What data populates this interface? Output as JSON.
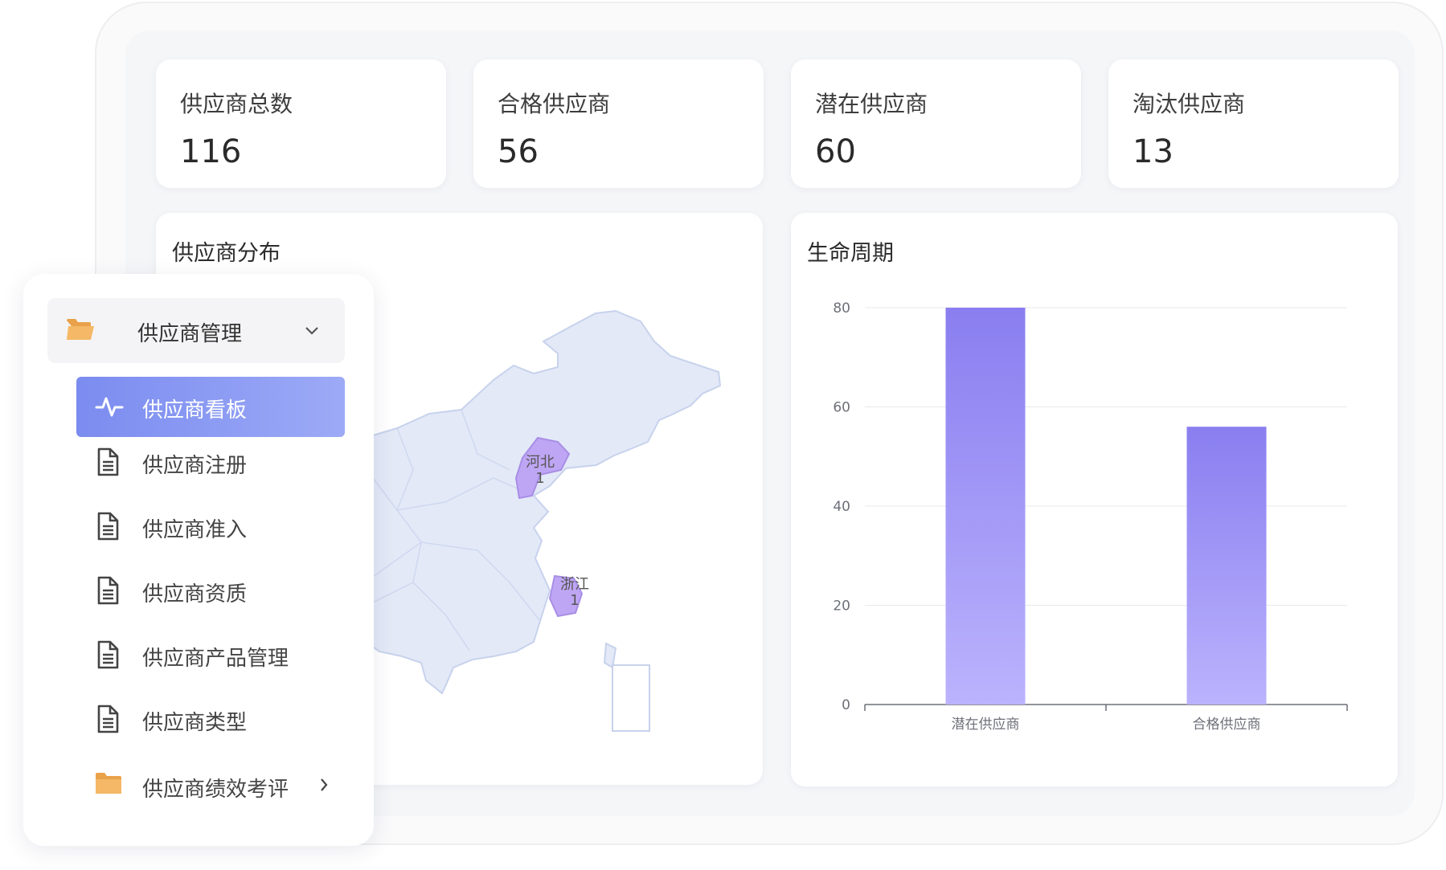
{
  "stats": [
    {
      "title": "供应商总数",
      "value": "116"
    },
    {
      "title": "合格供应商",
      "value": "56"
    },
    {
      "title": "潜在供应商",
      "value": "60"
    },
    {
      "title": "淘汰供应商",
      "value": "13"
    }
  ],
  "map_panel": {
    "title": "供应商分布",
    "regions": [
      {
        "name": "河北",
        "value": "1"
      },
      {
        "name": "浙江",
        "value": "1"
      }
    ]
  },
  "lifecycle_panel": {
    "title": "生命周期"
  },
  "chart_data": {
    "type": "bar",
    "title": "生命周期",
    "categories": [
      "潜在供应商",
      "合格供应商"
    ],
    "values": [
      80,
      56
    ],
    "ylim": [
      0,
      80
    ],
    "yticks": [
      0,
      20,
      40,
      60,
      80
    ],
    "grid": true,
    "colors": {
      "bar_top": "#8a7ef0",
      "bar_bottom": "#bbb3fd",
      "grid": "#e9e9ee",
      "axis": "#6e7079"
    }
  },
  "sidebar": {
    "group": {
      "label": "供应商管理",
      "icon": "folder-open-icon",
      "expand_icon": "chevron-down-icon"
    },
    "items": [
      {
        "label": "供应商看板",
        "icon": "activity-icon",
        "active": true
      },
      {
        "label": "供应商注册",
        "icon": "document-icon"
      },
      {
        "label": "供应商准入",
        "icon": "document-icon"
      },
      {
        "label": "供应商资质",
        "icon": "document-icon"
      },
      {
        "label": "供应商产品管理",
        "icon": "document-icon"
      },
      {
        "label": "供应商类型",
        "icon": "document-icon"
      },
      {
        "label": "供应商绩效考评",
        "icon": "folder-icon",
        "expand_icon": "chevron-right-icon"
      }
    ]
  },
  "colors": {
    "accent": "#7b8cf0",
    "folder": "#f2b05e",
    "map_fill": "#e3e9f7",
    "map_highlight": "#bfa6f4"
  }
}
